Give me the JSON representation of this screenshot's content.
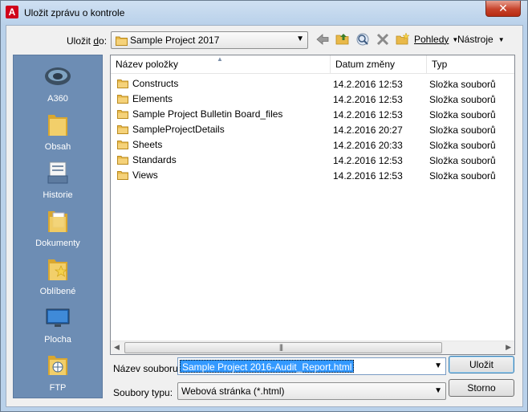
{
  "window": {
    "title": "Uložit zprávu o kontrole",
    "close_label": "✕"
  },
  "toolbar": {
    "save_in_label_prefix": "Uložit ",
    "save_in_label_key": "d",
    "save_in_label_suffix": "o:",
    "current_folder": "Sample Project 2017",
    "icons": [
      "back-arrow-icon",
      "up-folder-icon",
      "search-web-icon",
      "delete-icon",
      "new-folder-icon"
    ],
    "views_label": "Pohledy",
    "tools_label": "Nástroje"
  },
  "places": [
    {
      "label": "A360",
      "icon": "a360-cloud-icon"
    },
    {
      "label": "Obsah",
      "icon": "content-folder-icon"
    },
    {
      "label": "Historie",
      "icon": "history-icon"
    },
    {
      "label": "Dokumenty",
      "icon": "documents-folder-icon"
    },
    {
      "label": "Oblíbené",
      "icon": "favorites-folder-icon"
    },
    {
      "label": "Plocha",
      "icon": "desktop-icon"
    },
    {
      "label": "FTP",
      "icon": "ftp-icon"
    }
  ],
  "file_list": {
    "columns": [
      "Název položky",
      "Datum změny",
      "Typ"
    ],
    "rows": [
      {
        "name": "Constructs",
        "date": "14.2.2016 12:53",
        "type": "Složka souborů"
      },
      {
        "name": "Elements",
        "date": "14.2.2016 12:53",
        "type": "Složka souborů"
      },
      {
        "name": "Sample Project Bulletin Board_files",
        "date": "14.2.2016 12:53",
        "type": "Složka souborů"
      },
      {
        "name": "SampleProjectDetails",
        "date": "14.2.2016 20:27",
        "type": "Složka souborů"
      },
      {
        "name": "Sheets",
        "date": "14.2.2016 20:33",
        "type": "Složka souborů"
      },
      {
        "name": "Standards",
        "date": "14.2.2016 12:53",
        "type": "Složka souborů"
      },
      {
        "name": "Views",
        "date": "14.2.2016 12:53",
        "type": "Složka souborů"
      }
    ]
  },
  "form": {
    "file_name_label": "Název souboru:",
    "file_name_value": "Sample Project 2016-Audit_Report.html",
    "file_type_label": "Soubory typu:",
    "file_type_value": "Webová stránka (*.html)",
    "save_button": "Uložit",
    "cancel_button": "Storno"
  },
  "colors": {
    "places_bg": "#6d8db4",
    "folder_yellow": "#f0c24a",
    "selection": "#3399ff",
    "title_bg": "#b9d1ea"
  }
}
